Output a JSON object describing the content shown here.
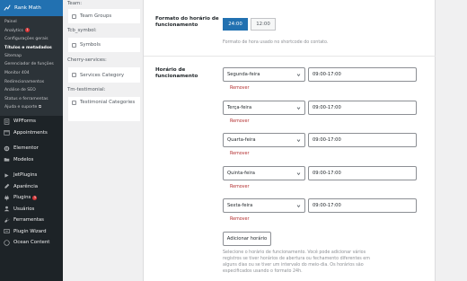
{
  "sidebar": {
    "plugin_title": "Rank Math",
    "submenu": [
      {
        "label": "Painel"
      },
      {
        "label": "Analytics",
        "badge": "1"
      },
      {
        "label": "Configurações gerais"
      },
      {
        "label": "Títulos e metadados",
        "current": true
      },
      {
        "label": "Sitemap"
      },
      {
        "label": "Gerenciador de funções"
      },
      {
        "label": "Monitor 404"
      },
      {
        "label": "Redirecionamentos"
      },
      {
        "label": "Análise de SEO"
      },
      {
        "label": "Status e ferramentas"
      },
      {
        "label": "Ajuda e suporte"
      }
    ],
    "menu": [
      {
        "label": "WPForms",
        "icon": "wpforms-icon"
      },
      {
        "label": "Appointments",
        "icon": "calendar-icon"
      },
      {
        "label": "Elementor",
        "icon": "elementor-icon"
      },
      {
        "label": "Modelos",
        "icon": "folder-icon"
      },
      {
        "label": "JetPlugins",
        "icon": "jetplugins-icon"
      },
      {
        "label": "Aparência",
        "icon": "brush-icon"
      },
      {
        "label": "Plugins",
        "icon": "plugin-icon",
        "badge": "3"
      },
      {
        "label": "Usuários",
        "icon": "users-icon"
      },
      {
        "label": "Ferramentas",
        "icon": "wrench-icon"
      },
      {
        "label": "Plugin Wizard",
        "icon": "wizard-icon"
      },
      {
        "label": "Ocean Content",
        "icon": "ocean-icon"
      }
    ]
  },
  "cpt": {
    "items": [
      {
        "type": "group",
        "label": "Team:"
      },
      {
        "type": "item",
        "label": "Team Groups"
      },
      {
        "type": "group",
        "label": "Tcb_symbol:"
      },
      {
        "type": "item",
        "label": "Symbols"
      },
      {
        "type": "group",
        "label": "Cherry-services:"
      },
      {
        "type": "item",
        "label": "Services Category"
      },
      {
        "type": "group",
        "label": "Tm-testimonial:"
      },
      {
        "type": "item",
        "label": "Testimonial Categories"
      }
    ]
  },
  "settings": {
    "format": {
      "label": "Formato do horário de funcionamento",
      "options": [
        "24:00",
        "12:00"
      ],
      "selected": "24:00",
      "help": "Formato de hora usado no shortcode do contato."
    },
    "hours": {
      "label": "Horário de funcionamento",
      "rows": [
        {
          "day": "Segunda-feira",
          "time": "09:00-17:00",
          "remove": "Remover"
        },
        {
          "day": "Terça-feira",
          "time": "09:00-17:00",
          "remove": "Remover"
        },
        {
          "day": "Quarta-feira",
          "time": "09:00-17:00",
          "remove": "Remover"
        },
        {
          "day": "Quinta-feira",
          "time": "09:00-17:00",
          "remove": "Remover"
        },
        {
          "day": "Sexta-feira",
          "time": "09:00-17:00",
          "remove": "Remover"
        }
      ],
      "add_button": "Adicionar horário",
      "help": "Selecione o horário de funcionamento. Você pode adicionar vários registros se tiver horários de abertura ou fechamento diferentes em alguns dias ou se tiver um intervalo do meio-dia. Os horários são especificados usando o formato 24h."
    }
  },
  "colors": {
    "sidebar_bg": "#1d2327",
    "accent": "#2271b1",
    "danger": "#b32d2e"
  }
}
